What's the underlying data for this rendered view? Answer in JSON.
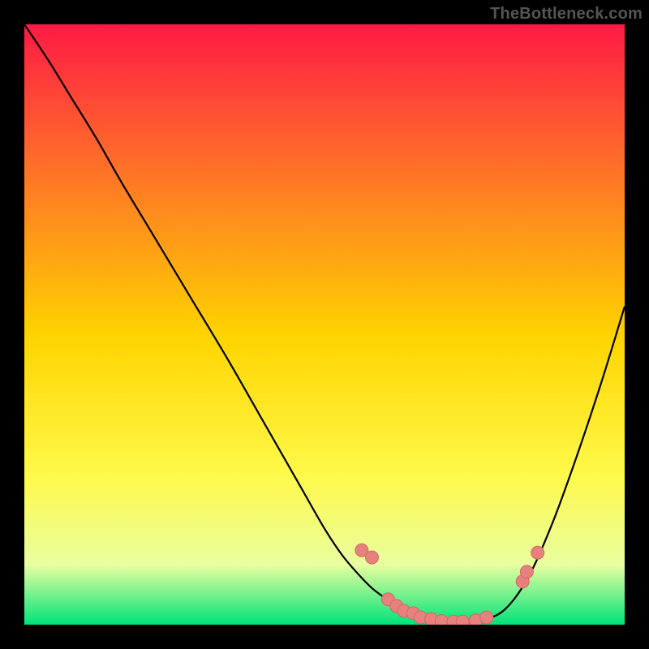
{
  "watermark": "TheBottleneck.com",
  "colors": {
    "gradient_stops": [
      "#ff1a45",
      "#ff6a2a",
      "#ffd400",
      "#fff94a",
      "#e9ffa0",
      "#00e37a"
    ],
    "curve": "#000000",
    "dot_fill": "#e8817e",
    "dot_stroke": "#d06763"
  },
  "chart_data": {
    "type": "line",
    "title": "",
    "xlabel": "",
    "ylabel": "",
    "xlim": [
      0,
      100
    ],
    "ylim": [
      0,
      100
    ],
    "series": [
      {
        "name": "bottleneck-curve",
        "x": [
          0,
          4,
          8,
          12,
          16,
          22,
          28,
          34,
          40,
          46,
          50,
          53,
          56,
          58,
          60,
          62,
          65,
          68,
          72,
          76,
          80,
          84,
          88,
          92,
          96,
          100
        ],
        "y": [
          100,
          94,
          87.5,
          81,
          74,
          64,
          54,
          44,
          33.5,
          23,
          16,
          11.5,
          8,
          6,
          4.5,
          3.2,
          1.8,
          0.9,
          0.4,
          0.7,
          2.5,
          8,
          17,
          28,
          40,
          53
        ]
      }
    ],
    "dots": {
      "name": "markers",
      "x": [
        56.2,
        57.9,
        60.6,
        62.0,
        63.2,
        64.8,
        66.0,
        67.8,
        69.5,
        71.5,
        73.0,
        75.2,
        77.0,
        83.0,
        83.7,
        85.5
      ],
      "y": [
        12.4,
        11.2,
        4.2,
        3.1,
        2.3,
        1.9,
        1.2,
        0.9,
        0.6,
        0.5,
        0.5,
        0.7,
        1.2,
        7.2,
        8.8,
        12.0
      ]
    },
    "dot_radius_px": 8
  }
}
